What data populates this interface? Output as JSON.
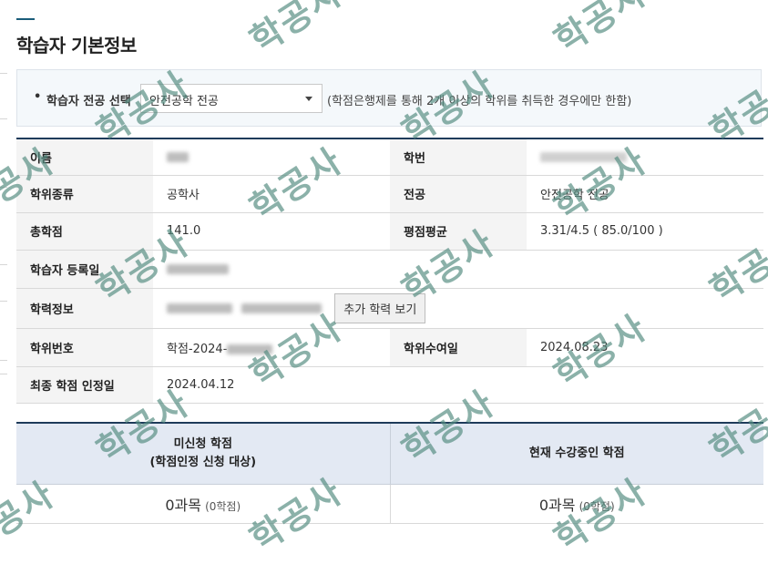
{
  "page": {
    "title": "학습자 기본정보"
  },
  "major": {
    "bullet": "•",
    "label": "학습자 전공 선택",
    "selected": "안전공학 전공",
    "note": "(학점은행제를 통해 2개 이상의 학위를 취득한 경우에만 한함)"
  },
  "info": {
    "name_label": "이름",
    "student_no_label": "학번",
    "degree_type_label": "학위종류",
    "degree_type_value": "공학사",
    "major_label": "전공",
    "major_value": "안전공학 전공",
    "total_credits_label": "총학점",
    "total_credits_value": "141.0",
    "gpa_label": "평점평균",
    "gpa_value": "3.31/4.5 ( 85.0/100 )",
    "reg_date_label": "학습자 등록일",
    "education_label": "학력정보",
    "more_button": "추가 학력 보기",
    "degree_no_label": "학위번호",
    "degree_no_prefix": "학점-2024-",
    "award_date_label": "학위수여일",
    "award_date_value": "2024.08.23",
    "final_credit_date_label": "최종 학점 인정일",
    "final_credit_date_value": "2024.04.12"
  },
  "credits": {
    "unapplied_header_line1": "미신청 학점",
    "unapplied_header_line2": "(학점인정 신청 대상)",
    "current_header": "현재 수강중인 학점",
    "unapplied_count": "0과목",
    "unapplied_credits": "(0학점)",
    "current_count": "0과목",
    "current_credits": "(0학점)"
  },
  "watermark": {
    "text": "학공사",
    "color": "#548c80"
  }
}
